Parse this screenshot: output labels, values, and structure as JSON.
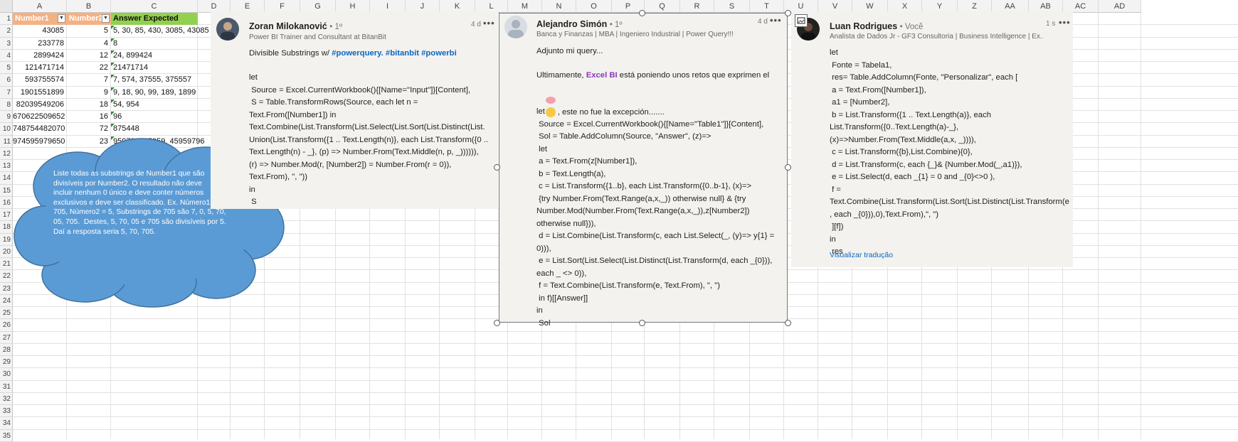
{
  "columns": [
    "A",
    "B",
    "C",
    "D",
    "E",
    "F",
    "G",
    "H",
    "I",
    "J",
    "K",
    "L",
    "M",
    "N",
    "O",
    "P",
    "Q",
    "R",
    "S",
    "T",
    "U",
    "V",
    "W",
    "X",
    "Y",
    "Z",
    "AA",
    "AB",
    "AC",
    "AD"
  ],
  "rows": [
    "1",
    "2",
    "3",
    "4",
    "5",
    "6",
    "7",
    "8",
    "9",
    "10",
    "11",
    "12",
    "13",
    "14",
    "15",
    "16",
    "17",
    "18",
    "19",
    "20",
    "21",
    "22",
    "23",
    "24",
    "25",
    "26",
    "27",
    "28",
    "29",
    "30",
    "31",
    "32",
    "33",
    "34",
    "35"
  ],
  "table": {
    "headers": [
      "Number1",
      "Number2",
      "Answer Expected"
    ],
    "rows": [
      [
        "43085",
        "5",
        "5, 30, 85, 430, 3085, 43085"
      ],
      [
        "233778",
        "4",
        "8"
      ],
      [
        "2899424",
        "12",
        "24, 899424"
      ],
      [
        "121471714",
        "22",
        "21471714"
      ],
      [
        "593755574",
        "7",
        "7, 574, 37555, 375557"
      ],
      [
        "1901551899",
        "9",
        "9, 18, 90, 99, 189, 1899"
      ],
      [
        "82039549206",
        "18",
        "54, 954"
      ],
      [
        "670622509652",
        "16",
        "96"
      ],
      [
        "748754482070",
        "72",
        "875448"
      ],
      [
        "974595979650",
        "23",
        "95979, 745959, 45959796"
      ]
    ]
  },
  "cloud_text": "Liste todas as substrings de Number1 que são\ndivisíveis por Number2. O resultado não deve\nincluir nenhum 0 único e deve conter números\nexclusivos e deve ser classificado. Ex. Número1 =\n705, Número2 = 5, Substrings de 705 são 7, 0, 5, 70,\n05, 705.  Destes, 5, 70, 05 e 705 são divisíveis por 5.\nDaí a resposta seria 5, 70, 705.",
  "post1": {
    "name": "Zoran Milokanović",
    "degree": "• 1º",
    "subtitle": "Power BI Trainer and Consultant at BitanBit",
    "time": "4 d",
    "more": "•••",
    "intro": "Divisible Substrings w/ ",
    "tags": "#powerquery. #bitanbit #powerbi",
    "code": "let\n Source = Excel.CurrentWorkbook(){[Name=\"Input\"]}[Content],\n S = Table.TransformRows(Source, each let n =\nText.From([Number1]) in\nText.Combine(List.Transform(List.Select(List.Sort(List.Distinct(List.\nUnion(List.Transform({1 .. Text.Length(n)}, each List.Transform({0 ..\nText.Length(n) - _}, (p) => Number.From(Text.Middle(n, p, _)))))),\n(r) => Number.Mod(r, [Number2]) = Number.From(r = 0)),\nText.From), \", \"))\nin\n S"
  },
  "post2": {
    "name": "Alejandro Simón",
    "degree": "• 1º",
    "subtitle": "Banca y Finanzas | MBA | Ingeniero Industrial | Power Query!!!",
    "time": "4 d",
    "more": "•••",
    "line1": "Adjunto mi query...",
    "line2a": "Ultimamente, ",
    "mention": "Excel BI",
    "line2b": " está poniendo unos retos que exprimen el",
    "line3": " , este no fue la excepción.......",
    "code": "let\n Source = Excel.CurrentWorkbook(){[Name=\"Table1\"]}[Content],\n Sol = Table.AddColumn(Source, \"Answer\", (z)=>\n let\n a = Text.From(z[Number1]),\n b = Text.Length(a),\n c = List.Transform({1..b}, each List.Transform({0..b-1}, (x)=>\n {try Number.From(Text.Range(a,x,_)) otherwise null} & {try\nNumber.Mod(Number.From(Text.Range(a,x,_)),z[Number2])\notherwise null})),\n d = List.Combine(List.Transform(c, each List.Select(_, (y)=> y{1} =\n0))),\n e = List.Sort(List.Select(List.Distinct(List.Transform(d, each _{0})),\neach _ <> 0)),\n f = Text.Combine(List.Transform(e, Text.From), \", \")\n in f)[[Answer]]\nin\n Sol"
  },
  "post3": {
    "name": "Luan Rodrigues",
    "degree": "• Você",
    "subtitle": "Analista de Dados Jr - GF3 Consultoria | Business Intelligence | Ex...",
    "time": "1 s",
    "more": "•••",
    "code": "let\n Fonte = Tabela1,\n res= Table.AddColumn(Fonte, \"Personalizar\", each [\n a = Text.From([Number1]),\n a1 = [Number2],\n b = List.Transform({1 .. Text.Length(a)}, each\nList.Transform({0..Text.Length(a)-_},\n(x)=>Number.From(Text.Middle(a,x, _)))),\n c = List.Transform({b},List.Combine){0},\n d = List.Transform(c, each {_}& {Number.Mod(_,a1)}),\n e = List.Select(d, each _{1} = 0 and _{0}<>0 ),\n f =\nText.Combine(List.Transform(List.Sort(List.Distinct(List.Transform(e\n, each _{0})),0),Text.From),\", \")\n ][f])\nin\n res",
    "translate": "Visualizar tradução"
  },
  "colors": {
    "orange_header": "#f4b183",
    "green_header": "#92d050",
    "cloud_fill": "#5b9bd5",
    "cloud_stroke": "#41719c",
    "link": "#0a66c2",
    "mention": "#8a3ab9"
  }
}
